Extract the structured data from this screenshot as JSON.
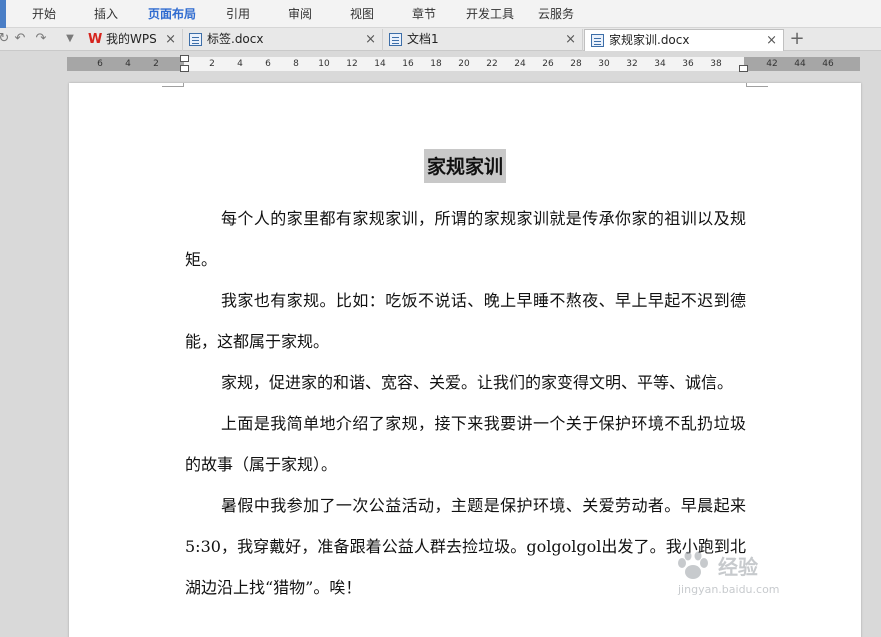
{
  "menu": {
    "items": [
      {
        "label": "开始",
        "active": false
      },
      {
        "label": "插入",
        "active": false
      },
      {
        "label": "页面布局",
        "active": true
      },
      {
        "label": "引用",
        "active": false
      },
      {
        "label": "审阅",
        "active": false
      },
      {
        "label": "视图",
        "active": false
      },
      {
        "label": "章节",
        "active": false
      },
      {
        "label": "开发工具",
        "active": false
      },
      {
        "label": "云服务",
        "active": false
      }
    ],
    "accent_color": "#2f6bd0"
  },
  "quick_access": {
    "icons": [
      "undo-icon",
      "redo-icon",
      "dropdown-arrow-icon"
    ]
  },
  "tabs": [
    {
      "label": "我的WPS",
      "icon": "wps-logo-icon",
      "active": false
    },
    {
      "label": "标签.docx",
      "icon": "document-icon",
      "active": false
    },
    {
      "label": "文档1",
      "icon": "document-icon",
      "active": false
    },
    {
      "label": "家规家训.docx",
      "icon": "document-icon",
      "active": true
    }
  ],
  "tab_close_glyph": "×",
  "add_tab_glyph": "+",
  "ruler": {
    "left_labels": [
      "6",
      "4",
      "2"
    ],
    "right_labels": [
      "2",
      "4",
      "6",
      "8",
      "10",
      "12",
      "14",
      "16",
      "18",
      "20",
      "22",
      "24",
      "26",
      "28",
      "30",
      "32",
      "34",
      "36",
      "38",
      "42",
      "44",
      "46"
    ]
  },
  "document": {
    "title": "家规家训",
    "paragraphs": [
      "每个人的家里都有家规家训，所谓的家规家训就是传承你家的祖训以及规矩。",
      "我家也有家规。比如：吃饭不说话、晚上早睡不熬夜、早上早起不迟到德能，这都属于家规。",
      "家规，促进家的和谐、宽容、关爱。让我们的家变得文明、平等、诚信。",
      "上面是我简单地介绍了家规，接下来我要讲一个关于保护环境不乱扔垃圾的故事（属于家规）。",
      "暑假中我参加了一次公益活动，主题是保护环境、关爱劳动者。早晨起来 5:30，我穿戴好，准备跟着公益人群去捡垃圾。golgolgol出发了。我小跑到北湖边沿上找“猎物”。唉！"
    ]
  },
  "watermark": {
    "text": "经验",
    "url": "jingyan.baidu.com",
    "icon": "baidu-paw-icon"
  }
}
